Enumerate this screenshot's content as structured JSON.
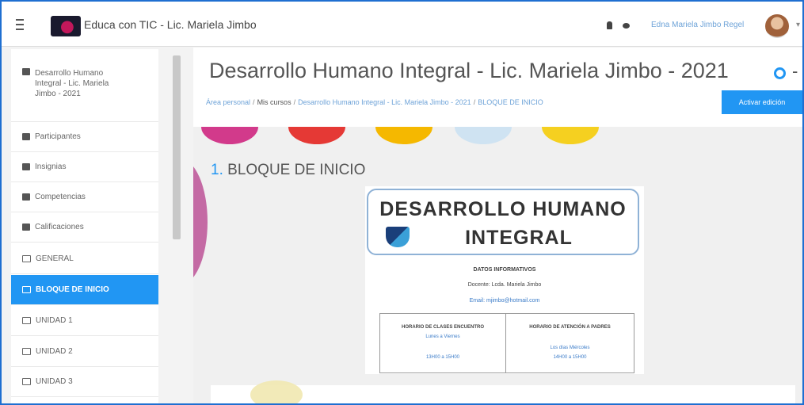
{
  "navbar": {
    "brand": "Educa con TIC - Lic. Mariela Jimbo",
    "user_name": "Edna Mariela Jimbo Regel",
    "caret": "▾"
  },
  "drawer": {
    "items": [
      {
        "label": "Desarrollo Humano Integral - Lic. Mariela Jimbo - 2021",
        "icon": "graduation-cap-icon"
      },
      {
        "label": "Participantes",
        "icon": "users-icon"
      },
      {
        "label": "Insignias",
        "icon": "shield-icon"
      },
      {
        "label": "Competencias",
        "icon": "checkbox-icon"
      },
      {
        "label": "Calificaciones",
        "icon": "table-icon"
      },
      {
        "label": "GENERAL",
        "icon": "folder-icon"
      },
      {
        "label": "BLOQUE DE INICIO",
        "icon": "folder-icon",
        "active": true
      },
      {
        "label": "UNIDAD 1",
        "icon": "folder-icon"
      },
      {
        "label": "UNIDAD 2",
        "icon": "folder-icon"
      },
      {
        "label": "UNIDAD 3",
        "icon": "folder-icon"
      }
    ]
  },
  "header": {
    "title": "Desarrollo Humano Integral - Lic. Mariela Jimbo - 2021",
    "breadcrumb": [
      "Área personal",
      "Mis cursos",
      "Desarrollo Humano Integral - Lic. Mariela Jimbo - 2021",
      "BLOQUE DE INICIO"
    ],
    "edit_button": "Activar edición"
  },
  "section": {
    "number": "1.",
    "title": "BLOQUE DE INICIO"
  },
  "poster": {
    "line1": "DESARROLLO HUMANO",
    "line2": "INTEGRAL",
    "info_title": "DATOS INFORMATIVOS",
    "docente": "Docente: Lcda. Mariela Jimbo",
    "email": "Email: mjimbo@hotmail.com",
    "col1_head": "HORARIO DE CLASES ENCUENTRO",
    "col1_days": "Lunes a Viernes",
    "col1_time": "13H00 a 15H00",
    "col2_head": "HORARIO DE ATENCIÓN A PADRES",
    "col2_days": "Los días Miércoles",
    "col2_time": "14H00 a 15H00"
  },
  "colors": {
    "accent": "#2196f3",
    "frame": "#1f6fd1"
  }
}
